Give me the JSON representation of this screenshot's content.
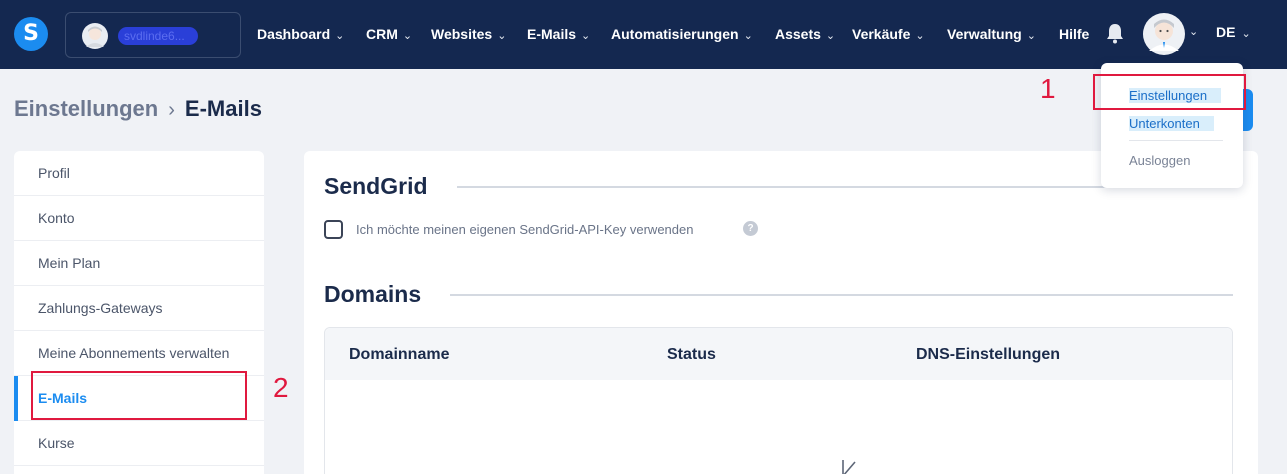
{
  "topnav": {
    "logo_letter": "S",
    "account_name": "svdlinde6...",
    "items": [
      {
        "label": "Dashboard",
        "chev": "⌄"
      },
      {
        "label": "CRM",
        "chev": "⌄"
      },
      {
        "label": "Websites",
        "chev": "⌄"
      },
      {
        "label": "E-Mails",
        "chev": "⌄"
      },
      {
        "label": "Automatisierungen",
        "chev": "⌄"
      },
      {
        "label": "Assets",
        "chev": "⌄"
      },
      {
        "label": "Verkäufe",
        "chev": "⌄"
      },
      {
        "label": "Verwaltung",
        "chev": "⌄"
      },
      {
        "label": "Hilfe",
        "chev": ""
      }
    ],
    "language": "DE",
    "chev_glyph": "⌄",
    "icons": {
      "bell": "bell-icon",
      "avatar": "avatar-icon"
    }
  },
  "breadcrumb": {
    "parent": "Einstellungen",
    "separator": "›",
    "current": "E-Mails"
  },
  "sidebar": {
    "items": [
      {
        "label": "Profil",
        "active": false
      },
      {
        "label": "Konto",
        "active": false
      },
      {
        "label": "Mein Plan",
        "active": false
      },
      {
        "label": "Zahlungs-Gateways",
        "active": false
      },
      {
        "label": "Meine Abonnements verwalten",
        "active": false
      },
      {
        "label": "E-Mails",
        "active": true
      },
      {
        "label": "Kurse",
        "active": false
      }
    ]
  },
  "main": {
    "sendgrid": {
      "title": "SendGrid",
      "checkbox_label": "Ich möchte meinen eigenen SendGrid-API-Key verwenden",
      "help_glyph": "?"
    },
    "domains": {
      "title": "Domains",
      "columns": [
        "Domainname",
        "Status",
        "DNS-Einstellungen"
      ]
    }
  },
  "dropdown": {
    "items": [
      "Einstellungen",
      "Unterkonten",
      "Ausloggen"
    ]
  },
  "annotations": {
    "first": "1",
    "second": "2"
  },
  "colors": {
    "nav_bg": "#142850",
    "accent": "#1b8cf0",
    "annotation": "#e0193f"
  }
}
